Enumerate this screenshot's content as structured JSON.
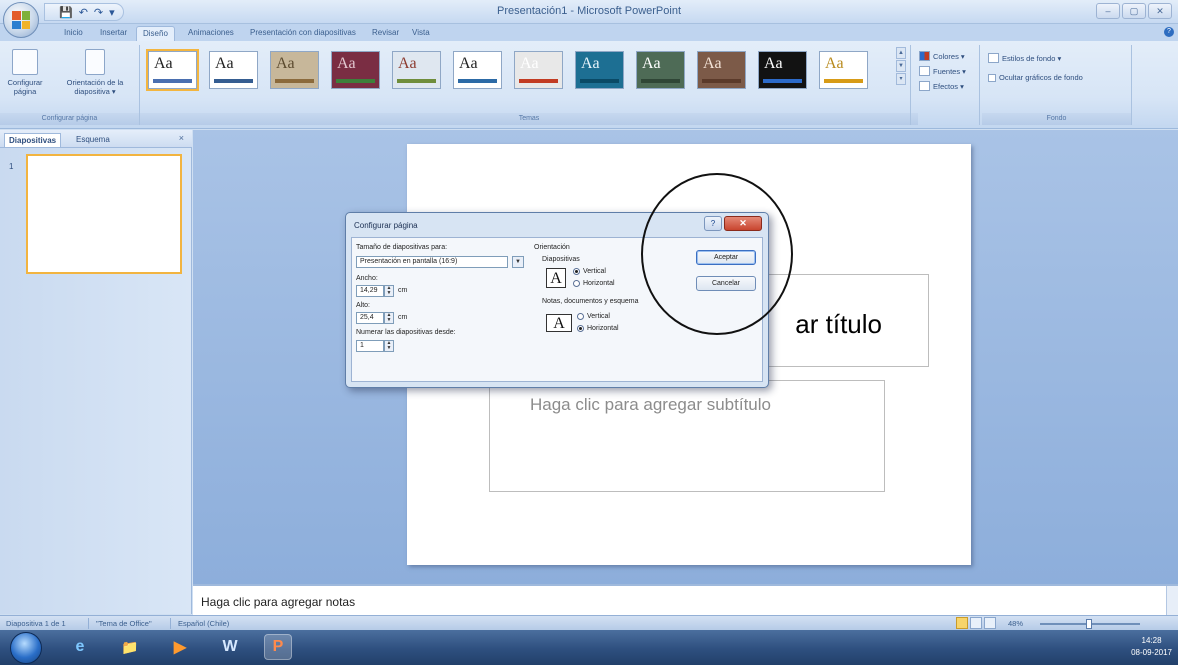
{
  "window": {
    "title": "Presentación1 - Microsoft PowerPoint",
    "controls": [
      "–",
      "▢",
      "✕"
    ]
  },
  "qat": {
    "save": "💾",
    "undo": "↶",
    "redo": "↷",
    "more": "▾"
  },
  "tabs": [
    "Inicio",
    "Insertar",
    "Diseño",
    "Animaciones",
    "Presentación con diapositivas",
    "Revisar",
    "Vista"
  ],
  "active_tab": "Diseño",
  "ribbon": {
    "page_setup": {
      "config_label": "Configurar página",
      "orient_label": "Orientación de la diapositiva ▾",
      "group_label": "Configurar página"
    },
    "themes": {
      "group_label": "Temas",
      "sample": "Aa",
      "options": [
        {
          "bg": "#ffffff",
          "fg": "#222222",
          "bar": "#4a6fb0"
        },
        {
          "bg": "#ffffff",
          "fg": "#222222",
          "bar": "#355d91"
        },
        {
          "bg": "#c7b79a",
          "fg": "#5b4a2e",
          "bar": "#8b6a3c"
        },
        {
          "bg": "#7a2d43",
          "fg": "#e3c7d0",
          "bar": "#3d7f3b"
        },
        {
          "bg": "#dfe7f0",
          "fg": "#8c3b2f",
          "bar": "#6f8d3b"
        },
        {
          "bg": "#ffffff",
          "fg": "#222222",
          "bar": "#2c6aa6"
        },
        {
          "bg": "#e8e8e8",
          "fg": "#ffffff",
          "bar": "#c23b22"
        },
        {
          "bg": "#1d6f93",
          "fg": "#e7f4fb",
          "bar": "#0a4a66"
        },
        {
          "bg": "#4e6b56",
          "fg": "#ffffff",
          "bar": "#2f4636"
        },
        {
          "bg": "#7c5a48",
          "fg": "#f3e3d7",
          "bar": "#5b3a2a"
        },
        {
          "bg": "#121212",
          "fg": "#ffffff",
          "bar": "#2c6ac9"
        },
        {
          "bg": "#ffffff",
          "fg": "#b88a1d",
          "bar": "#d79b17"
        }
      ],
      "scroll": [
        "▲",
        "▼",
        "▾"
      ]
    },
    "theme_options": [
      "Colores ▾",
      "Fuentes ▾",
      "Efectos ▾"
    ],
    "background": {
      "styles": "Estilos de fondo ▾",
      "hide_graphics": "Ocultar gráficos de fondo",
      "group_label": "Fondo"
    }
  },
  "left_panel": {
    "tabs": [
      "Diapositivas",
      "Esquema"
    ],
    "close": "×",
    "slide_number": "1"
  },
  "slide": {
    "title_placeholder": "ar título",
    "subtitle_placeholder": "Haga clic para agregar subtítulo"
  },
  "notes": {
    "placeholder": "Haga clic para agregar notas"
  },
  "status": {
    "slide": "Diapositiva 1 de 1",
    "theme": "\"Tema de Office\"",
    "language": "Español (Chile)",
    "zoom": "48%"
  },
  "dialog": {
    "title": "Configurar página",
    "help": "?",
    "close": "✕",
    "size_label": "Tamaño de diapositivas para:",
    "size_value": "Presentación en pantalla (16:9)",
    "width_label": "Ancho:",
    "width_value": "14,29",
    "height_label": "Alto:",
    "height_value": "25,4",
    "unit": "cm",
    "number_label": "Numerar las diapositivas desde:",
    "number_value": "1",
    "orientation_label": "Orientación",
    "slides_label": "Diapositivas",
    "notes_label": "Notas, documentos y esquema",
    "vertical": "Vertical",
    "horizontal": "Horizontal",
    "slides_orientation": "vertical",
    "notes_orientation": "horizontal",
    "orient_icon": "A",
    "ok": "Aceptar",
    "cancel": "Cancelar"
  },
  "taskbar": {
    "apps": [
      "e",
      "📁",
      "▶",
      "W",
      "P"
    ],
    "clock_time": "14:28",
    "clock_date": "08-09-2017"
  }
}
